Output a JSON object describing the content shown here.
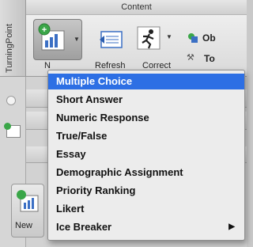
{
  "side_tab": {
    "label": "TurningPoint"
  },
  "ribbon": {
    "group_title": "Content",
    "buttons": [
      {
        "label": "N",
        "icon": "new-slide-icon"
      },
      {
        "label": "Refresh",
        "icon": "refresh-icon"
      },
      {
        "label": "Correct",
        "icon": "runner-icon"
      },
      {
        "label": "Ob",
        "icon": "object-icon"
      },
      {
        "label": "To",
        "icon": "tool-icon"
      }
    ]
  },
  "lower": {
    "new_label": "New"
  },
  "menu": {
    "items": [
      {
        "label": "Multiple Choice",
        "selected": true
      },
      {
        "label": "Short Answer"
      },
      {
        "label": "Numeric Response"
      },
      {
        "label": "True/False"
      },
      {
        "label": "Essay"
      },
      {
        "label": "Demographic Assignment"
      },
      {
        "label": "Priority Ranking"
      },
      {
        "label": "Likert"
      },
      {
        "label": "Ice Breaker",
        "submenu": true
      }
    ],
    "submenu_arrow": "▶"
  },
  "colors": {
    "selection": "#2d6fe4",
    "icon_green": "#3aa648",
    "icon_blue": "#3b6fc4"
  }
}
